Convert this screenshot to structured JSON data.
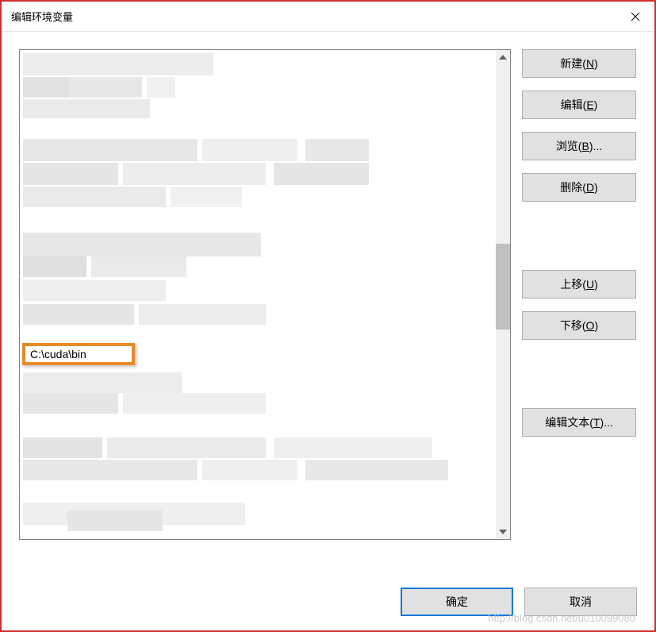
{
  "window": {
    "title": "编辑环境变量"
  },
  "list": {
    "highlighted_value": "C:\\cuda\\bin"
  },
  "buttons": {
    "new": {
      "prefix": "新建(",
      "hotkey": "N",
      "suffix": ")"
    },
    "edit": {
      "prefix": "编辑(",
      "hotkey": "E",
      "suffix": ")"
    },
    "browse": {
      "prefix": "浏览(",
      "hotkey": "B",
      "suffix": ")..."
    },
    "delete": {
      "prefix": "删除(",
      "hotkey": "D",
      "suffix": ")"
    },
    "move_up": {
      "prefix": "上移(",
      "hotkey": "U",
      "suffix": ")"
    },
    "move_down": {
      "prefix": "下移(",
      "hotkey": "O",
      "suffix": ")"
    },
    "edit_text": {
      "prefix": "编辑文本(",
      "hotkey": "T",
      "suffix": ")..."
    },
    "ok": "确定",
    "cancel": "取消"
  },
  "watermark": "http://blog.csdn.net/u010099080"
}
